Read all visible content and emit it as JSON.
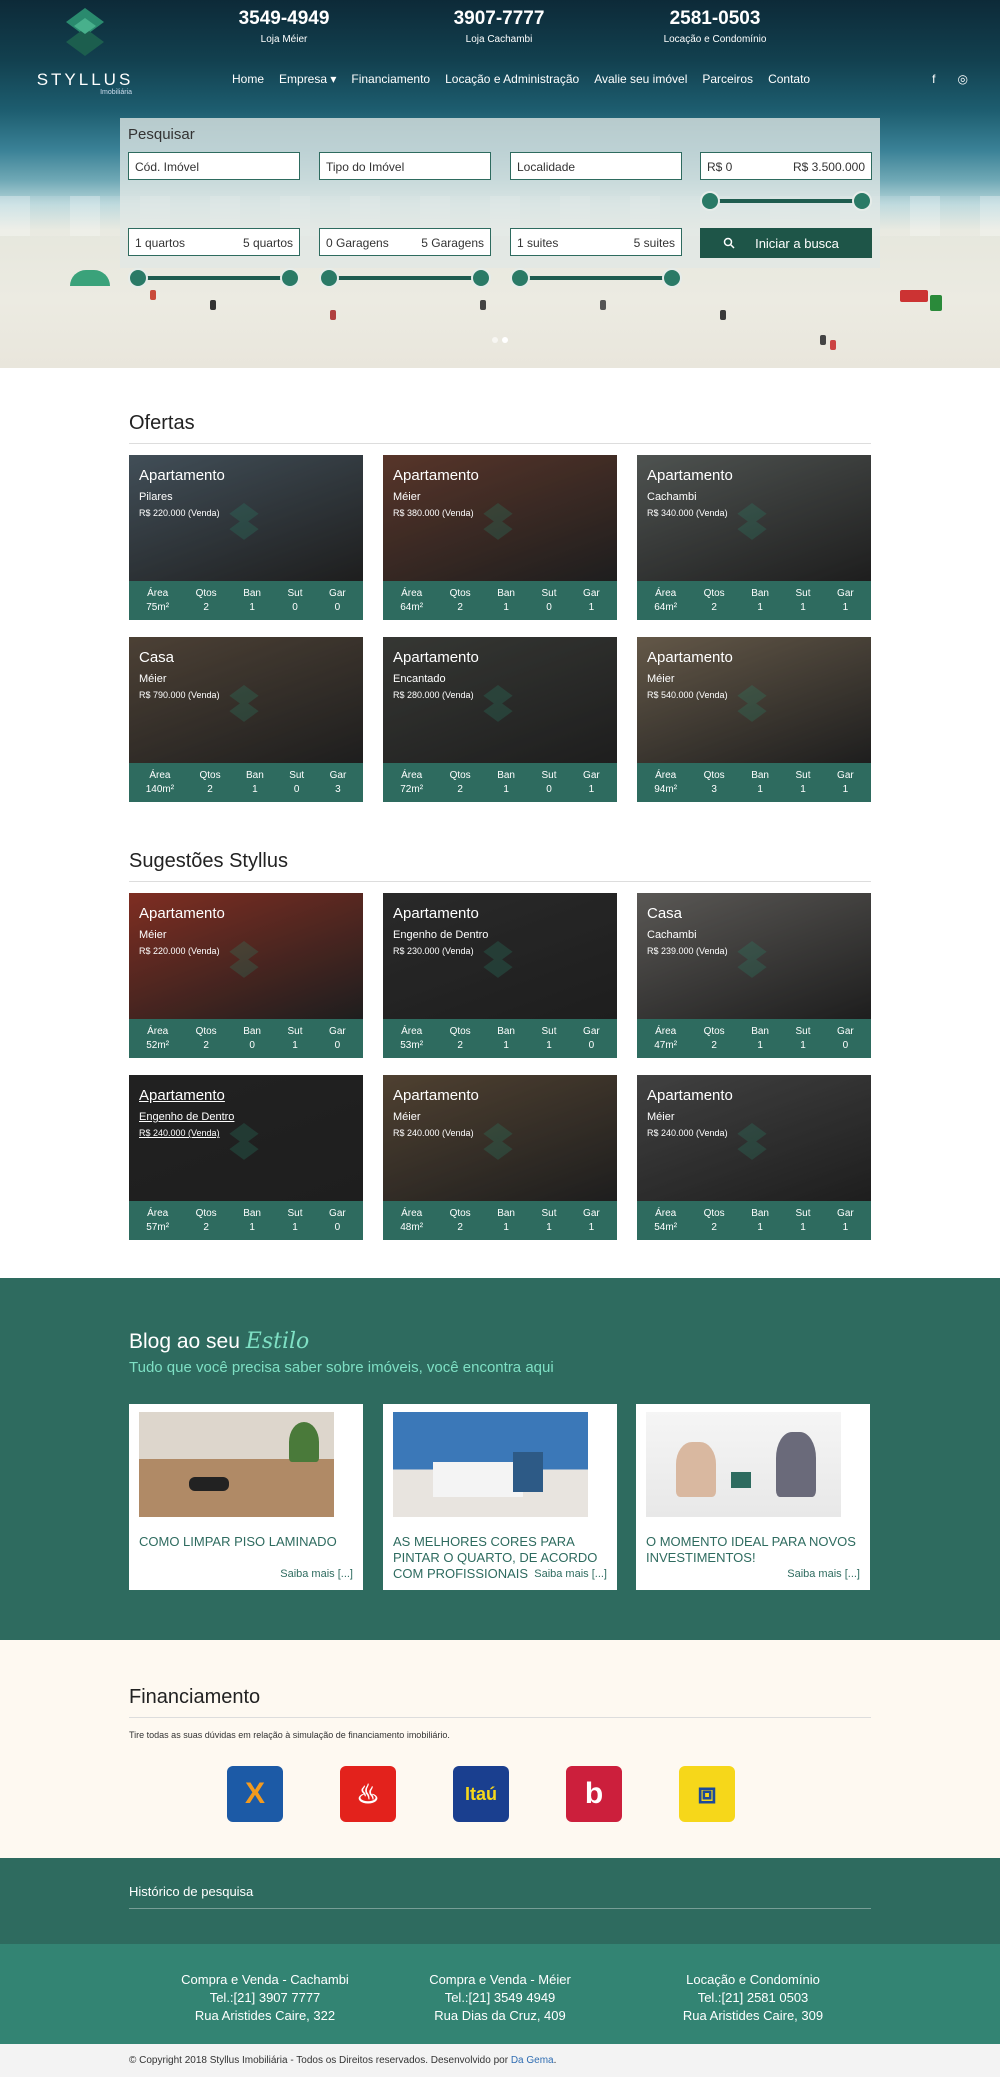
{
  "header": {
    "logo_name": "STYLLUS",
    "logo_sub": "Imobiliária",
    "phones": [
      {
        "number": "3549-4949",
        "label": "Loja Méier"
      },
      {
        "number": "3907-7777",
        "label": "Loja Cachambi"
      },
      {
        "number": "2581-0503",
        "label": "Locação e Condomínio"
      }
    ],
    "nav": [
      "Home",
      "Empresa ▾",
      "Financiamento",
      "Locação e Administração",
      "Avalie seu imóvel",
      "Parceiros",
      "Contato"
    ],
    "social": {
      "facebook": "f",
      "instagram": "◎"
    }
  },
  "search": {
    "title": "Pesquisar",
    "cod_imovel": "Cód. Imóvel",
    "tipo_imovel": "Tipo do Imóvel",
    "localidade": "Localidade",
    "price_min": "R$ 0",
    "price_max": "R$ 3.500.000",
    "quartos_min": "1 quartos",
    "quartos_max": "5 quartos",
    "garagens_min": "0 Garagens",
    "garagens_max": "5 Garagens",
    "suites_min": "1 suites",
    "suites_max": "5 suites",
    "button": "Iniciar a busca",
    "button_icon": "search-icon"
  },
  "spec_labels": [
    "Área",
    "Qtos",
    "Ban",
    "Sut",
    "Gar"
  ],
  "ofertas": {
    "title": "Ofertas",
    "items": [
      {
        "type": "Apartamento",
        "loc": "Pilares",
        "price": "R$ 220.000 (Venda)",
        "specs": [
          "75m²",
          "2",
          "1",
          "0",
          "0"
        ],
        "color": "#5b6d7a"
      },
      {
        "type": "Apartamento",
        "loc": "Méier",
        "price": "R$ 380.000 (Venda)",
        "specs": [
          "64m²",
          "2",
          "1",
          "0",
          "1"
        ],
        "color": "#7a4a3a"
      },
      {
        "type": "Apartamento",
        "loc": "Cachambi",
        "price": "R$ 340.000 (Venda)",
        "specs": [
          "64m²",
          "2",
          "1",
          "1",
          "1"
        ],
        "color": "#6d7370"
      },
      {
        "type": "Casa",
        "loc": "Méier",
        "price": "R$ 790.000 (Venda)",
        "specs": [
          "140m²",
          "2",
          "1",
          "0",
          "3"
        ],
        "color": "#6a5a4a"
      },
      {
        "type": "Apartamento",
        "loc": "Encantado",
        "price": "R$ 280.000 (Venda)",
        "specs": [
          "72m²",
          "2",
          "1",
          "0",
          "1"
        ],
        "color": "#4b4d48"
      },
      {
        "type": "Apartamento",
        "loc": "Méier",
        "price": "R$ 540.000 (Venda)",
        "specs": [
          "94m²",
          "3",
          "1",
          "1",
          "1"
        ],
        "color": "#8a7a64"
      }
    ]
  },
  "sugestoes": {
    "title": "Sugestões Styllus",
    "items": [
      {
        "type": "Apartamento",
        "loc": "Méier",
        "price": "R$ 220.000 (Venda)",
        "specs": [
          "52m²",
          "2",
          "0",
          "1",
          "0"
        ],
        "color": "#b04030"
      },
      {
        "type": "Apartamento",
        "loc": "Engenho de Dentro",
        "price": "R$ 230.000 (Venda)",
        "specs": [
          "53m²",
          "2",
          "1",
          "1",
          "0"
        ],
        "color": "#3a3a3a"
      },
      {
        "type": "Casa",
        "loc": "Cachambi",
        "price": "R$ 239.000 (Venda)",
        "specs": [
          "47m²",
          "2",
          "1",
          "1",
          "0"
        ],
        "color": "#7d7a76"
      },
      {
        "type": "Apartamento",
        "loc": "Engenho de Dentro",
        "price": "R$ 240.000 (Venda)",
        "specs": [
          "57m²",
          "2",
          "1",
          "1",
          "0"
        ],
        "color": "#2f2f2f"
      },
      {
        "type": "Apartamento",
        "loc": "Méier",
        "price": "R$ 240.000 (Venda)",
        "specs": [
          "48m²",
          "2",
          "1",
          "1",
          "1"
        ],
        "color": "#6e5a44"
      },
      {
        "type": "Apartamento",
        "loc": "Méier",
        "price": "R$ 240.000 (Venda)",
        "specs": [
          "54m²",
          "2",
          "1",
          "1",
          "1"
        ],
        "color": "#5a5a5a"
      }
    ]
  },
  "blog": {
    "title": "Blog ao seu",
    "title_script": "Estilo",
    "subtitle": "Tudo que você precisa saber sobre imóveis, você encontra aqui",
    "posts": [
      {
        "title": "COMO LIMPAR PISO LAMINADO",
        "more": "Saiba mais [...]"
      },
      {
        "title": "AS MELHORES CORES PARA PINTAR O QUARTO, DE ACORDO COM PROFISSIONAIS",
        "more": "Saiba mais [...]"
      },
      {
        "title": "O MOMENTO IDEAL PARA NOVOS INVESTIMENTOS!",
        "more": "Saiba mais [...]"
      }
    ]
  },
  "financiamento": {
    "title": "Financiamento",
    "description": "Tire todas as suas dúvidas em relação à simulação de financiamento imobiliário.",
    "banks": [
      {
        "name": "caixa",
        "label": "X",
        "color": "#1c5aa6"
      },
      {
        "name": "santander",
        "label": "♨",
        "color": "#e3221c"
      },
      {
        "name": "itau",
        "label": "Itaú",
        "color": "#1a3f8f"
      },
      {
        "name": "bradesco",
        "label": "b",
        "color": "#cc1f3c"
      },
      {
        "name": "banco-do-brasil",
        "label": "⧈",
        "color": "#f6d71a"
      }
    ]
  },
  "historico": {
    "title": "Histórico de pesquisa"
  },
  "stores": [
    {
      "name": "Compra e Venda - Cachambi",
      "tel": "Tel.:[21] 3907 7777",
      "addr": "Rua Aristides Caire, 322"
    },
    {
      "name": "Compra e Venda - Méier",
      "tel": "Tel.:[21] 3549 4949",
      "addr": "Rua Dias da Cruz, 409"
    },
    {
      "name": "Locação e Condomínio",
      "tel": "Tel.:[21] 2581 0503",
      "addr": "Rua Aristides Caire, 309"
    }
  ],
  "footer": {
    "copyright": "© Copyright 2018 Styllus Imobiliária - Todos os Direitos reservados. Desenvolvido por",
    "dev": "Da Gema",
    "dot": "."
  }
}
